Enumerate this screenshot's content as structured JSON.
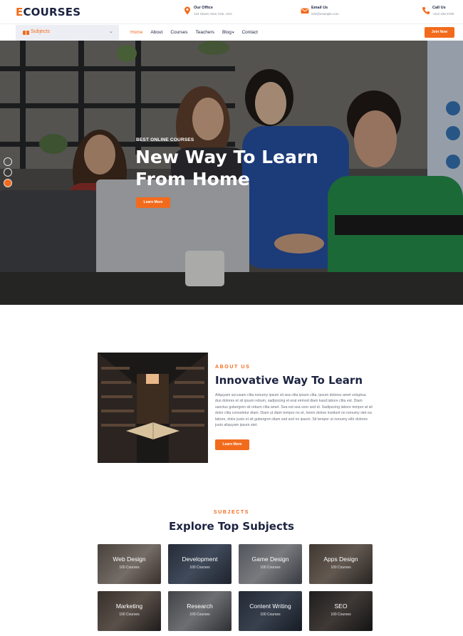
{
  "brand": {
    "logo_initial": "E",
    "logo_rest": "COURSES"
  },
  "contacts": [
    {
      "title": "Our Office",
      "value": "123 Street, New York, USA",
      "icon": "map-marker-icon"
    },
    {
      "title": "Email Us",
      "value": "info@example.com",
      "icon": "envelope-icon"
    },
    {
      "title": "Call Us",
      "value": "+012 345 6789",
      "icon": "phone-icon"
    }
  ],
  "nav": {
    "subjects_label": "Subjects",
    "links": [
      "Home",
      "About",
      "Courses",
      "Teachers",
      "Blog",
      "Contact"
    ],
    "active": "Home",
    "join_label": "Join Now"
  },
  "hero": {
    "kicker": "BEST ONLINE COURSES",
    "title_line1": "New Way To Learn",
    "title_line2": "From Home",
    "button": "Learn More",
    "active_slide": 3
  },
  "about": {
    "eyebrow": "ABOUT US",
    "title": "Innovative Way To Learn",
    "text": "Aliquyam accusam clita nonumy ipsum sit sea clita ipsum clita, ipsum dolores amet voluptua duo dolores et sit ipsum rebum, sadipscing et erat eirmod diam kasd labore clita est. Diam sanctus gubergren sit rebum clita amet. Sea est sea vero sed et. Sadipscing labore tempor at sit dolor clita consetetur diam. Diam ut diam tempor no et, lorem dolore invidunt no nonumy stet ea labore, dolor justo et sit gubergren diam sed sed no ipsum. Sit tempor ut nonumy elitr dolores justo aliquyam ipsum stet.",
    "button": "Learn More"
  },
  "subjects": {
    "eyebrow": "SUBJECTS",
    "title": "Explore Top Subjects",
    "cards": [
      {
        "name": "Web Design",
        "count": "100 Courses"
      },
      {
        "name": "Development",
        "count": "100 Courses"
      },
      {
        "name": "Game Design",
        "count": "100 Courses"
      },
      {
        "name": "Apps Design",
        "count": "100 Courses"
      },
      {
        "name": "Marketing",
        "count": "100 Courses"
      },
      {
        "name": "Research",
        "count": "100 Courses"
      },
      {
        "name": "Content Writing",
        "count": "100 Courses"
      },
      {
        "name": "SEO",
        "count": "100 Courses"
      }
    ]
  },
  "colors": {
    "accent": "#f26b1d",
    "heading": "#1c2340",
    "body_text": "#6a6f7c"
  }
}
